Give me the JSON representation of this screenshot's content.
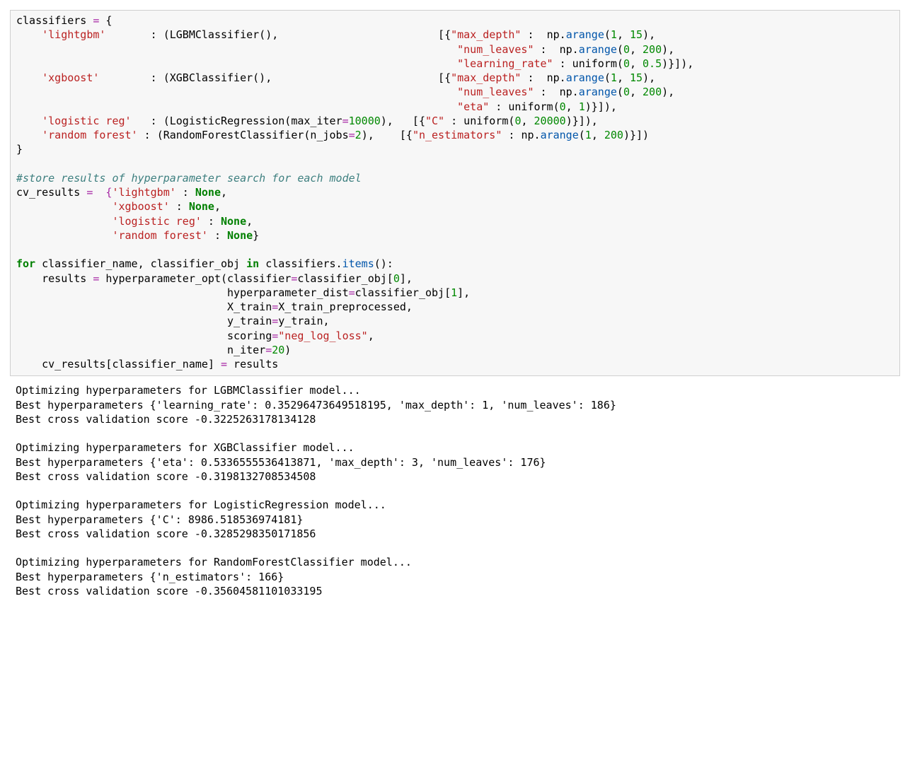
{
  "code": {
    "t1": "classifiers ",
    "eq": "=",
    "lb": " {",
    "pad1": "    ",
    "s_lgbm": "'lightgbm'",
    "pad_lgbm": "      ",
    "colon": " : ",
    "c_lgbm": "(LGBMClassifier(),",
    "pad_lgbm2": "                         [{",
    "s_maxd": "\"max_depth\"",
    "np_arange": " :  np.",
    "arange": "arange",
    "num1": "1",
    "num15": "15",
    "pad_align": "                                                                     ",
    "s_numl": "\"num_leaves\"",
    "num0": "0",
    "num200": "200",
    "s_lr": "\"learning_rate\"",
    "uniform": " : uniform(",
    "num05": "0.5",
    "s_xgb": "'xgboost'",
    "pad_xgb": "       ",
    "c_xgb": "(XGBClassifier(),",
    "pad_xgb2": "                          [{",
    "s_eta": "\"eta\"",
    "s_lreg": "'logistic reg'",
    "c_lreg1": "(LogisticRegression(max_iter",
    "num10000": "10000",
    "c_lreg2": "),   [{",
    "s_C": "\"C\"",
    "num20000": "20000",
    "s_rf": "'random forest'",
    "c_rf1": "(RandomForestClassifier(n_jobs",
    "num2": "2",
    "c_rf2": "),    [{",
    "s_nest": "\"n_estimators\"",
    "kw_for": "for",
    "kw_in": "in",
    "kw_none": "None",
    "comment1": "#store results of hyperparameter search for each model",
    "cv_res": "cv_results ",
    "cv_open": "=  {",
    "s_lgbm2": "'lightgbm'",
    "s_xgb2": "'xgboost'",
    "s_lreg2": "'logistic reg'",
    "s_rf2": "'random forest'",
    "for_line": " classifier_name, classifier_obj ",
    "items": "items",
    "for_end": " classifiers.",
    "res_eq": "    results ",
    "ho": " hyperparameter_opt(classifier",
    "co0": "classifier_obj[",
    "co1": "classifier_obj[",
    "hp_pad": "                                 ",
    "hp_dist": "hyperparameter_dist",
    "xtrain": "X_train",
    "xtrainp": "X_train_preprocessed,",
    "ytrain": "y_train",
    "ytrainv": "y_train,",
    "scoring": "scoring",
    "nll": "\"neg_log_loss\"",
    "niter": "n_iter",
    "num20": "20",
    "cvr": "    cv_results[classifier_name] ",
    "cvr2": " results"
  },
  "output": "Optimizing hyperparameters for LGBMClassifier model...\nBest hyperparameters {'learning_rate': 0.35296473649518195, 'max_depth': 1, 'num_leaves': 186}\nBest cross validation score -0.3225263178134128\n\nOptimizing hyperparameters for XGBClassifier model...\nBest hyperparameters {'eta': 0.5336555536413871, 'max_depth': 3, 'num_leaves': 176}\nBest cross validation score -0.3198132708534508\n\nOptimizing hyperparameters for LogisticRegression model...\nBest hyperparameters {'C': 8986.518536974181}\nBest cross validation score -0.3285298350171856\n\nOptimizing hyperparameters for RandomForestClassifier model...\nBest hyperparameters {'n_estimators': 166}\nBest cross validation score -0.35604581101033195"
}
